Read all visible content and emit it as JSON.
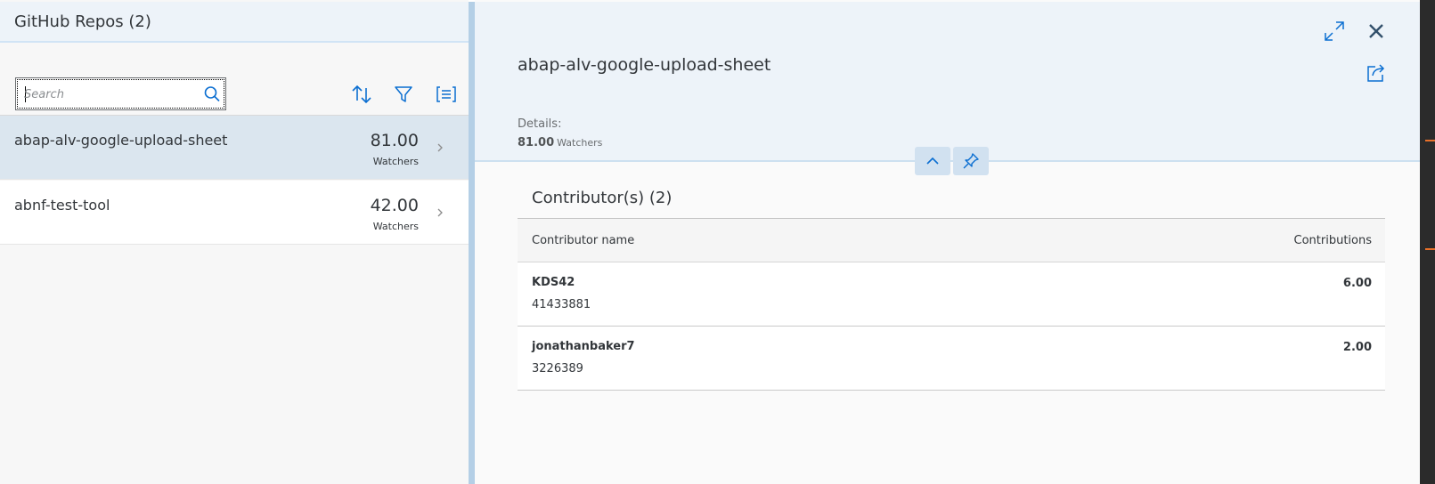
{
  "master": {
    "title": "GitHub Repos (2)",
    "search": {
      "placeholder": "Search",
      "value": ""
    },
    "toolbar": {
      "sort_icon": "sort-icon",
      "filter_icon": "filter-icon",
      "group_icon": "group-icon"
    },
    "items": [
      {
        "name": "abap-alv-google-upload-sheet",
        "number": "81.00",
        "unit": "Watchers",
        "selected": true
      },
      {
        "name": "abnf-test-tool",
        "number": "42.00",
        "unit": "Watchers",
        "selected": false
      }
    ]
  },
  "detail": {
    "title": "abap-alv-google-upload-sheet",
    "details_label": "Details:",
    "watchers_value": "81.00",
    "watchers_unit": "Watchers",
    "contributors": {
      "title": "Contributor(s) (2)",
      "columns": [
        "Contributor name",
        "Contributions"
      ],
      "rows": [
        {
          "name": "KDS42",
          "id": "41433881",
          "contributions": "6.00"
        },
        {
          "name": "jonathanbaker7",
          "id": "3226389",
          "contributions": "2.00"
        }
      ]
    }
  },
  "colors": {
    "accent": "#0a6ed1",
    "selected_row": "#dbe6ef",
    "header_bg": "#edf3f9",
    "edge_marker": "#e8702a"
  }
}
